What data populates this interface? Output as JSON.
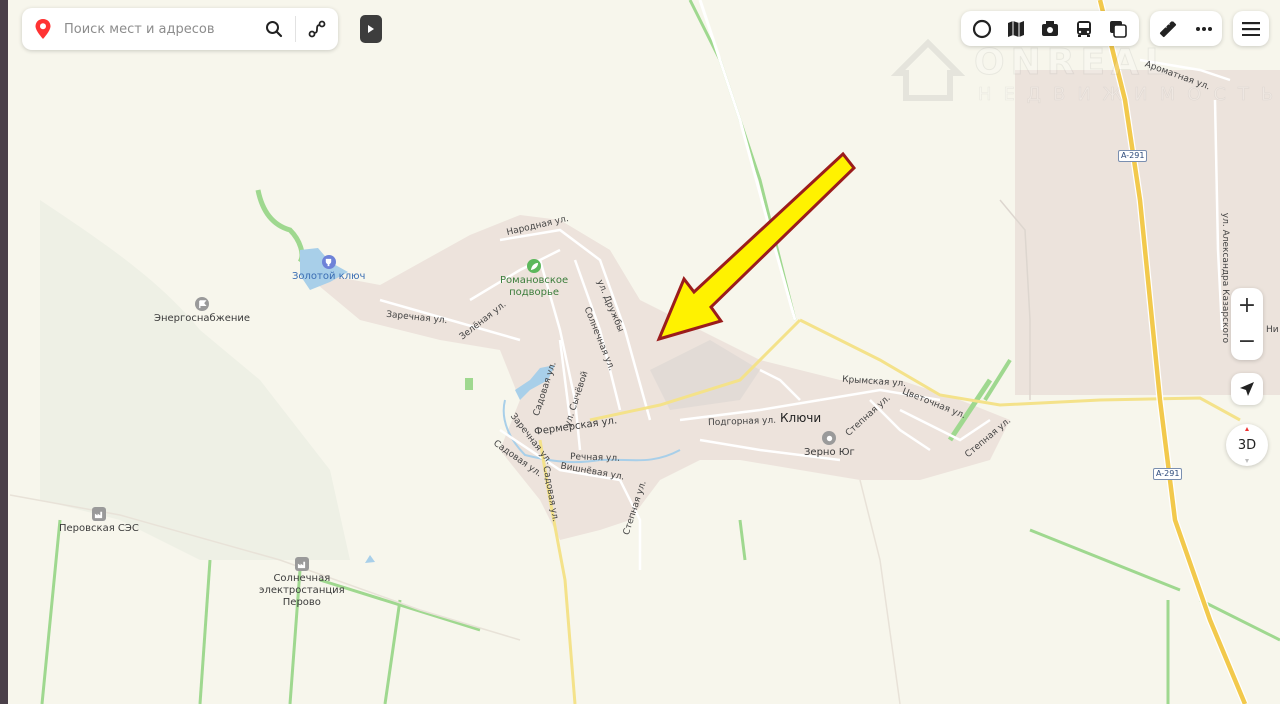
{
  "search": {
    "placeholder": "Поиск мест и адресов"
  },
  "controls": {
    "zoom_in": "+",
    "zoom_out": "−",
    "view_3d": "3D"
  },
  "watermark": {
    "brand": "ONREAL",
    "subtitle": "НЕДВИЖИМОСТЬ"
  },
  "map": {
    "places": {
      "village": "Ключи",
      "zolotoy_klyuch": "Золотой ключ",
      "romanovskoe_line1": "Романовское",
      "romanovskoe_line2": "подворье",
      "energosnab": "Энергоснабжение",
      "perovo_ses": "Перовская СЭС",
      "solar_line1": "Солнечная",
      "solar_line2": "электростанция",
      "solar_line3": "Перово",
      "zerno_yug": "Зерно Юг"
    },
    "streets": {
      "narodnaya": "Народная ул.",
      "zarechnaya_north": "Заречная ул.",
      "zelenaya": "Зелёная ул.",
      "druzhby": "ул. Дружбы",
      "solnechnaya": "Солнечная ул.",
      "sadovaya_north": "Садовая ул.",
      "sycheva": "ул. Сычёвой",
      "fermerskaya": "Фермерская ул.",
      "zarechnaya_south": "Заречная ул.",
      "sadovaya_west": "Садовая ул.",
      "rechnaya": "Речная ул.",
      "vishnevaya": "Вишнёвая ул.",
      "sadovaya_south": "Садовая ул.",
      "stepnaya_south": "Степная ул.",
      "podgornaya": "Подгорная ул.",
      "krymskaya": "Крымская ул.",
      "stepnaya_mid": "Степная ул.",
      "tsvetochnaya": "Цветочная ул.",
      "stepnaya_east": "Степная ул.",
      "aromatnaya": "Ароматная ул.",
      "kazarskogo": "ул. Александра Казарского",
      "ni": "Ни"
    },
    "road_badges": {
      "north": "A-291",
      "south": "A-291"
    }
  },
  "colors": {
    "land": "#f7f6ec",
    "settlement": "#ede3dc",
    "industrial": "#e7dcd8",
    "highway": "#f2c94c",
    "arrow_fill": "#fff200",
    "arrow_stroke": "#9b1c1c",
    "water": "#a8cfe9",
    "vegetation": "#9fd88f"
  }
}
